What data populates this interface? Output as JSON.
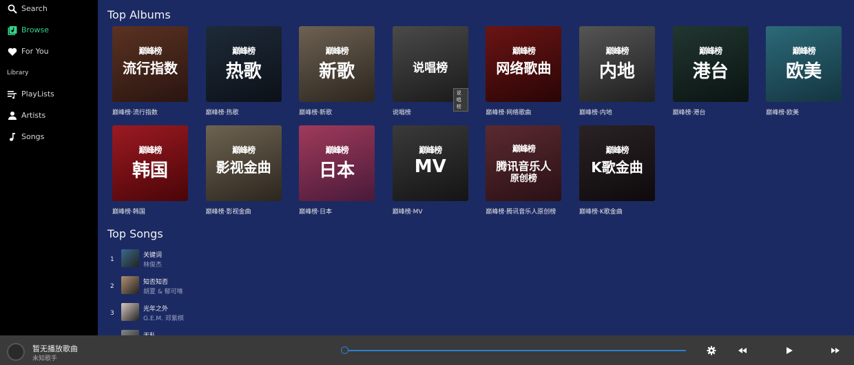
{
  "sidebar": {
    "search": "Search",
    "browse": "Browse",
    "for_you": "For You",
    "library_heading": "Library",
    "playlists": "PlayLists",
    "artists": "Artists",
    "songs": "Songs"
  },
  "colors": {
    "accent": "#35d28a",
    "main_bg": "#1c2a63",
    "progress": "#2e7ed6"
  },
  "top_albums": {
    "title": "Top Albums",
    "brand": "巅峰榜",
    "tooltip": "说唱榜",
    "items": [
      {
        "cover_text": "流行指数",
        "caption": "巅峰榜·流行指数",
        "bg": "#5a3222",
        "bg2": "#2a1510"
      },
      {
        "cover_text": "热歌",
        "caption": "巅峰榜·热歌",
        "bg": "#1e2a38",
        "bg2": "#0c1118"
      },
      {
        "cover_text": "新歌",
        "caption": "巅峰榜·新歌",
        "bg": "#6d6152",
        "bg2": "#2c261e"
      },
      {
        "cover_text": "说唱榜",
        "caption": "说唱榜",
        "bg": "#4a4a4a",
        "bg2": "#1a1a1a"
      },
      {
        "cover_text": "网络歌曲",
        "caption": "巅峰榜·网络歌曲",
        "bg": "#6b1414",
        "bg2": "#2a0505"
      },
      {
        "cover_text": "内地",
        "caption": "巅峰榜·内地",
        "bg": "#555555",
        "bg2": "#1f1f1f"
      },
      {
        "cover_text": "港台",
        "caption": "巅峰榜·港台",
        "bg": "#223630",
        "bg2": "#0a1412"
      },
      {
        "cover_text": "欧美",
        "caption": "巅峰榜·欧美",
        "bg": "#2c6a78",
        "bg2": "#143440"
      },
      {
        "cover_text": "韩国",
        "caption": "巅峰榜·韩国",
        "bg": "#9c1a22",
        "bg2": "#4a0508"
      },
      {
        "cover_text": "影视金曲",
        "caption": "巅峰榜·影视金曲",
        "bg": "#6e6352",
        "bg2": "#2c261e"
      },
      {
        "cover_text": "日本",
        "caption": "巅峰榜·日本",
        "bg": "#a03a5a",
        "bg2": "#4a1a3a"
      },
      {
        "cover_text": "MV",
        "caption": "巅峰榜·MV",
        "bg": "#3a3a3a",
        "bg2": "#141414"
      },
      {
        "cover_text": "腾讯音乐人",
        "cover_text2": "原创榜",
        "caption": "巅峰榜·腾讯音乐人原创榜",
        "bg": "#5a2a30",
        "bg2": "#2a1015"
      },
      {
        "cover_text": "K歌金曲",
        "caption": "巅峰榜·K歌金曲",
        "bg": "#2a2224",
        "bg2": "#0e0a0b"
      }
    ]
  },
  "top_songs": {
    "title": "Top Songs",
    "items": [
      {
        "rank": "1",
        "name": "关键词",
        "artist": "林俊杰",
        "bg": "#3a6a8a"
      },
      {
        "rank": "2",
        "name": "知否知否",
        "artist": "胡夏 & 郁可唯",
        "bg": "#b09070"
      },
      {
        "rank": "3",
        "name": "光年之外",
        "artist": "G.E.M. 邓紫棋",
        "bg": "#d8c8c0"
      },
      {
        "rank": "",
        "name": "无私",
        "artist": "",
        "bg": "#888888"
      }
    ]
  },
  "player": {
    "title": "暂无播放歌曲",
    "artist": "未知歌手"
  }
}
